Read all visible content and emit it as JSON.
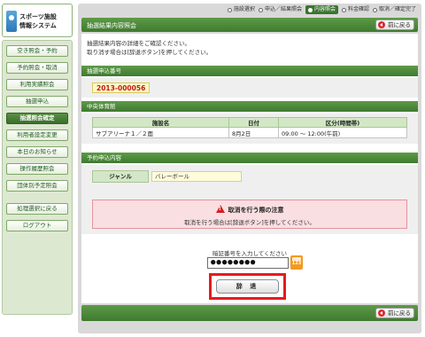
{
  "logo": {
    "line1": "スポーツ施設",
    "line2": "情報システム"
  },
  "sidebar": {
    "items": [
      {
        "label": "空き照会・予約",
        "active": false
      },
      {
        "label": "予約照会・取消",
        "active": false
      },
      {
        "label": "利用実績照会",
        "active": false
      },
      {
        "label": "抽選申込",
        "active": false
      },
      {
        "label": "抽選照会確定",
        "active": true
      },
      {
        "label": "利用者設定変更",
        "active": false
      },
      {
        "label": "本日のお知らせ",
        "active": false
      },
      {
        "label": "操作履歴照会",
        "active": false
      },
      {
        "label": "団体別予定照会",
        "active": false
      }
    ],
    "footer_items": [
      {
        "label": "処理選択に戻る"
      },
      {
        "label": "ログアウト"
      }
    ]
  },
  "steps": [
    {
      "label": "施設選択",
      "current": false
    },
    {
      "label": "申込／結果照会",
      "current": false
    },
    {
      "label": "内容照会",
      "current": true
    },
    {
      "label": "料金確認",
      "current": false
    },
    {
      "label": "取消／確定完了",
      "current": false
    }
  ],
  "header": {
    "title": "抽選結果内容照会",
    "back_label": "前に戻る"
  },
  "intro": {
    "line1": "抽選結果内容の詳細をご確認ください。",
    "line2": "取り消す場合は[辞退ボタン]を押してください。"
  },
  "application_number": {
    "heading": "抽選申込番号",
    "value": "2013-000056"
  },
  "facility": {
    "heading": "中央体育館",
    "columns": [
      "施設名",
      "日付",
      "区分(時間帯)"
    ],
    "rows": [
      [
        "サブアリーナ１／２面",
        "8月2日",
        "09:00 ～ 12:00(午前)"
      ]
    ]
  },
  "reservation": {
    "heading": "予約申込内容",
    "genre_label": "ジャンル",
    "genre_value": "バレーボール"
  },
  "warning": {
    "title": "取消を行う際の注意",
    "text": "取消を行う場合は[辞退ボタン]を押してください。"
  },
  "pin": {
    "label": "暗証番号を入力してください",
    "value": "●●●●●●●●",
    "keypad_label": "123"
  },
  "submit": {
    "label": "辞 退"
  },
  "footer": {
    "back_label": "前に戻る"
  },
  "colors": {
    "accent_green": "#4a8a3a",
    "warning_bg": "#fadfe2",
    "highlight_red": "#e51c1c",
    "number_red": "#c0181b"
  }
}
